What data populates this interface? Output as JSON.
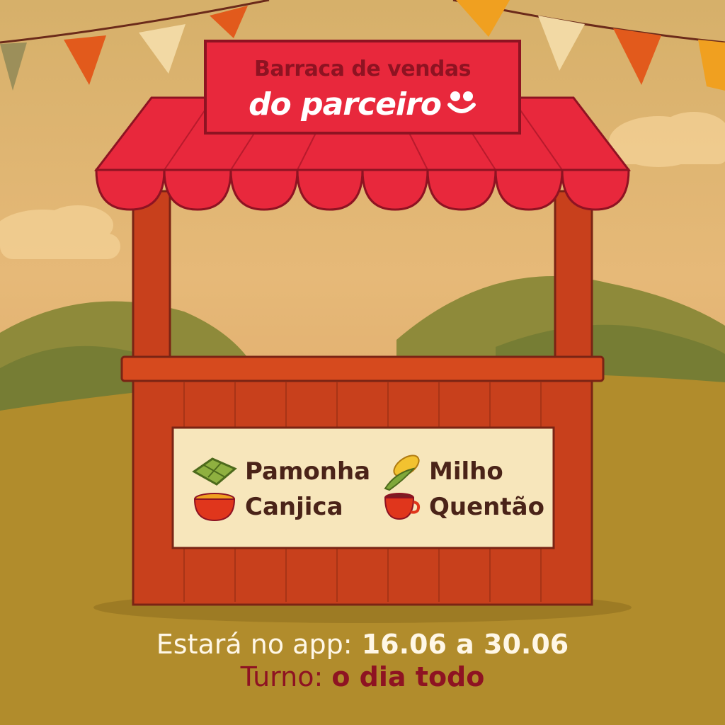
{
  "sign": {
    "line1": "Barraca de vendas",
    "line2": "do parceiro"
  },
  "menu": {
    "items": [
      {
        "label": "Pamonha",
        "icon": "pamonha-icon"
      },
      {
        "label": "Milho",
        "icon": "corn-icon"
      },
      {
        "label": "Canjica",
        "icon": "bowl-icon"
      },
      {
        "label": "Quentão",
        "icon": "mug-icon"
      }
    ]
  },
  "footer": {
    "availability_prefix": "Estará no app:",
    "availability_dates": "16.06 a 30.06",
    "shift_prefix": "Turno:",
    "shift_value": "o dia todo"
  },
  "colors": {
    "brand_red": "#e8283c",
    "dark_red": "#8e1322",
    "stall_wood": "#c8401c",
    "sky": "#e6b978",
    "grass": "#a8842a"
  }
}
